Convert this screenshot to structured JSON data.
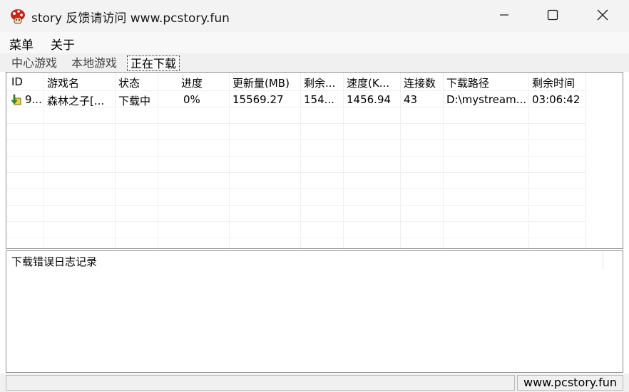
{
  "window": {
    "title": "story 反馈请访问 www.pcstory.fun",
    "icon": "mushroom-app-icon",
    "controls": [
      "minimize-icon",
      "maximize-icon",
      "close-icon"
    ]
  },
  "menu": {
    "items": [
      {
        "label": "菜单"
      },
      {
        "label": "关于"
      }
    ]
  },
  "tabs": [
    {
      "label": "中心游戏",
      "active": false
    },
    {
      "label": "本地游戏",
      "active": false
    },
    {
      "label": "正在下载",
      "active": true
    }
  ],
  "table": {
    "columns": [
      "ID",
      "游戏名",
      "状态",
      "进度",
      "更新量(MB)",
      "剩余...",
      "速度(K...",
      "连接数",
      "下载路径",
      "剩余时间"
    ],
    "rows": [
      {
        "icon": "download-arrow-icon",
        "cells": [
          "9...",
          "森林之子[...",
          "下载中",
          "0%",
          "15569.27",
          "154...",
          "1456.94",
          "43",
          "D:\\mystream...",
          "03:06:42"
        ]
      }
    ]
  },
  "log": {
    "title": "下载错误日志记录"
  },
  "status": {
    "left": "",
    "right": "www.pcstory.fun"
  }
}
